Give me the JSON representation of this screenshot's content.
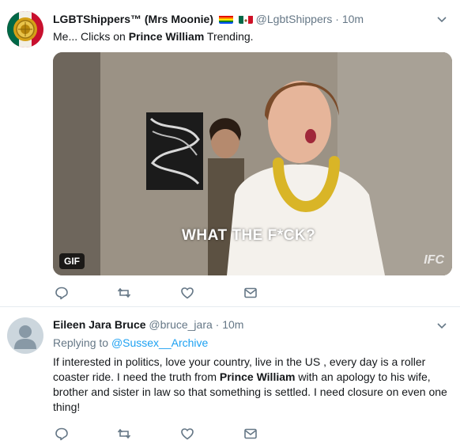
{
  "tweet1": {
    "display_name": "LGBTShippers™ (Mrs Moonie)",
    "flags": [
      "rainbow-flag-icon",
      "mexico-flag-icon"
    ],
    "handle": "@LgbtShippers",
    "separator": "·",
    "time": "10m",
    "text_before": "Me... Clicks on ",
    "text_bold": "Prince William",
    "text_after": " Trending.",
    "media": {
      "badge": "GIF",
      "caption": "WHAT THE F*CK?",
      "watermark": "IFC"
    },
    "actions": [
      "reply-icon",
      "retweet-icon",
      "like-icon",
      "direct-message-icon"
    ]
  },
  "tweet2": {
    "display_name": "Eileen Jara Bruce",
    "handle": "@bruce_jara",
    "separator": "·",
    "time": "10m",
    "replying_label": "Replying to ",
    "replying_handle": "@Sussex__Archive",
    "line1": "If interested in politics, love your country, live in the US , every day is a roller",
    "line2_before": "coaster ride.  I need the truth from ",
    "line2_bold": "Prince William",
    "line2_after": " with an apology to his wife,",
    "line3": "brother and sister in law so that something is settled.  I need closure on even one",
    "line4": "thing!",
    "actions": [
      "reply-icon",
      "retweet-icon",
      "like-icon",
      "direct-message-icon"
    ]
  },
  "colors": {
    "text": "#14171a",
    "secondary": "#657786",
    "link": "#1da1f2",
    "divider": "#e6ecf0"
  }
}
